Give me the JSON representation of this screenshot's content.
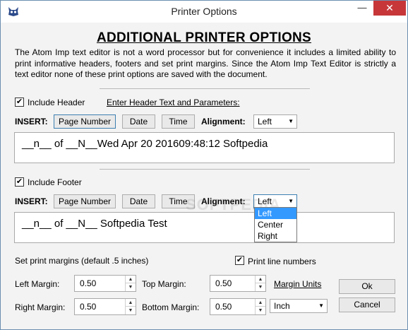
{
  "window": {
    "title": "Printer Options",
    "minimize_glyph": "—",
    "close_glyph": "✕",
    "app_icon": "atom-imp-icon"
  },
  "heading": "ADDITIONAL PRINTER OPTIONS",
  "intro": "The Atom Imp text editor is not a word processor but for convenience it includes a limited ability to print informative headers, footers and set print margins. Since the Atom Imp Text Editor is strictly a text editor none of these print options are saved with the document.",
  "header_section": {
    "checkbox_checked": true,
    "checkbox_label": "Include Header",
    "link": "Enter Header Text and Parameters:",
    "insert_label": "INSERT:",
    "page_number_button": "Page Number",
    "date_button": "Date",
    "time_button": "Time",
    "alignment_label": "Alignment:",
    "alignment_value": "Left",
    "text": "__n__ of __N__Wed Apr 20 201609:48:12 Softpedia"
  },
  "footer_section": {
    "checkbox_checked": true,
    "checkbox_label": "Include Footer",
    "insert_label": "INSERT:",
    "page_number_button": "Page Number",
    "date_button": "Date",
    "time_button": "Time",
    "alignment_label": "Alignment:",
    "alignment_value": "Left",
    "alignment_options": [
      "Left",
      "Center",
      "Right"
    ],
    "alignment_selected": "Left",
    "text": "__n__ of __N__ Softpedia Test"
  },
  "margins": {
    "heading": "Set print margins (default .5 inches)",
    "print_line_numbers_checked": true,
    "print_line_numbers_label": "Print line numbers",
    "left_label": "Left Margin:",
    "left_value": "0.50",
    "top_label": "Top Margin:",
    "top_value": "0.50",
    "right_label": "Right Margin:",
    "right_value": "0.50",
    "bottom_label": "Bottom Margin:",
    "bottom_value": "0.50",
    "units_link": "Margin Units",
    "units_value": "Inch"
  },
  "actions": {
    "ok": "Ok",
    "cancel": "Cancel"
  },
  "watermark": "SOFTPEDIA",
  "colors": {
    "close_button": "#c7373a",
    "selection": "#3399ff",
    "focus_border": "#3c7fb1"
  }
}
